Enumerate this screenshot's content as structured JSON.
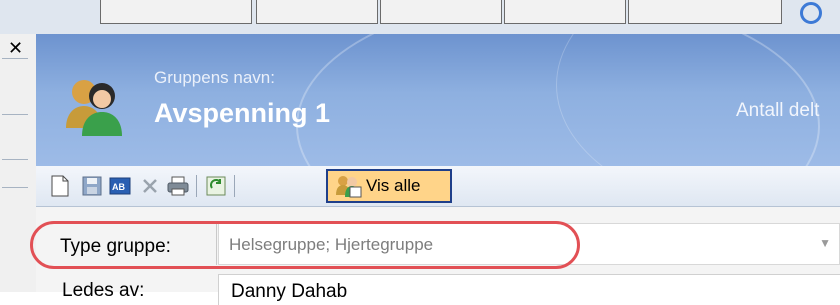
{
  "header": {
    "group_label": "Gruppens navn:",
    "group_name": "Avspenning 1",
    "count_label": "Antall delt"
  },
  "toolbar": {
    "vis_alle_label": "Vis alle"
  },
  "form": {
    "type_label": "Type gruppe:",
    "type_value": "Helsegruppe; Hjertegruppe",
    "led_by_label": "Ledes av:",
    "led_by_value": "Danny Dahab"
  },
  "colors": {
    "highlight": "#e25055",
    "header_blue": "#8eb0e0",
    "vis_alle_bg": "#ffd489"
  }
}
